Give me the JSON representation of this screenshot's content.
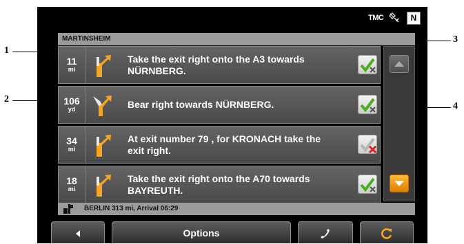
{
  "status_bar": {
    "tmc_label": "TMC",
    "gps_icon": "satellite-icon",
    "compass_label": "N"
  },
  "current_street": "MARTINSHEIM",
  "route_list": [
    {
      "distance": "11",
      "unit": "mi",
      "icon": "exit-right-arrow-icon",
      "instruction": "Take the exit right onto the A3 towards NÜRNBERG.",
      "check_state": "enabled"
    },
    {
      "distance": "106",
      "unit": "yd",
      "icon": "bear-right-arrow-icon",
      "instruction": "Bear right towards NÜRNBERG.",
      "check_state": "enabled"
    },
    {
      "distance": "34",
      "unit": "mi",
      "icon": "exit-right-arrow-icon",
      "instruction": "At exit number 79 , for KRONACH take the exit right.",
      "check_state": "blocked"
    },
    {
      "distance": "18",
      "unit": "mi",
      "icon": "exit-right-arrow-icon",
      "instruction": "Take the exit right onto the A70 towards BAYREUTH.",
      "check_state": "enabled"
    }
  ],
  "destination_bar": "BERLIN 313 mi, Arrival 06:29",
  "toolbar": {
    "back_icon": "back-arrow-icon",
    "options_label": "Options",
    "phone_icon": "phone-icon",
    "recalc_icon": "recalculate-icon"
  },
  "annotations": {
    "a1": "1",
    "a2": "2",
    "a3": "3",
    "a4": "4"
  },
  "colors": {
    "accent_orange": "#f5a623",
    "row_gray": "#555555",
    "check_green": "#4caf1e",
    "check_red": "#e02020"
  }
}
